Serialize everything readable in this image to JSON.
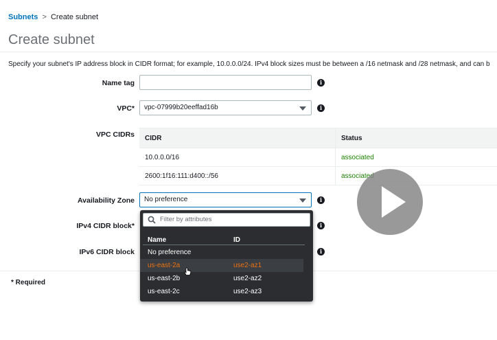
{
  "breadcrumb": {
    "parent": "Subnets",
    "separator": ">",
    "current": "Create subnet"
  },
  "page": {
    "title": "Create subnet",
    "description": "Specify your subnet's IP address block in CIDR format; for example, 10.0.0.0/24. IPv4 block sizes must be between a /16 netmask and /28 netmask, and can b"
  },
  "form": {
    "name_tag": {
      "label": "Name tag",
      "value": ""
    },
    "vpc": {
      "label": "VPC*",
      "value": "vpc-07999b20eeffad16b"
    },
    "vpc_cidrs": {
      "label": "VPC CIDRs",
      "columns": [
        "CIDR",
        "Status"
      ],
      "rows": [
        {
          "cidr": "10.0.0.0/16",
          "status": "associated"
        },
        {
          "cidr": "2600:1f16:111:d400::/56",
          "status": "associated"
        }
      ]
    },
    "availability_zone": {
      "label": "Availability Zone",
      "value": "No preference"
    },
    "ipv4_cidr": {
      "label": "IPv4 CIDR block*"
    },
    "ipv6_cidr": {
      "label": "IPv6 CIDR block"
    },
    "info_glyph": "i",
    "required_note": "* Required"
  },
  "dropdown": {
    "filter_placeholder": "Filter by attributes",
    "columns": [
      "Name",
      "ID"
    ],
    "options": [
      {
        "name": "No preference",
        "id": ""
      },
      {
        "name": "us-east-2a",
        "id": "use2-az1",
        "highlighted": true
      },
      {
        "name": "us-east-2b",
        "id": "use2-az2"
      },
      {
        "name": "us-east-2c",
        "id": "use2-az3"
      }
    ]
  },
  "colors": {
    "link": "#0073bb",
    "highlight": "#ec7211",
    "status_ok": "#1d8102",
    "dropdown_bg": "#2b2d30"
  },
  "icons": [
    "info-icon",
    "chevron-down-icon",
    "search-icon",
    "pointer-cursor-icon",
    "play-icon"
  ]
}
